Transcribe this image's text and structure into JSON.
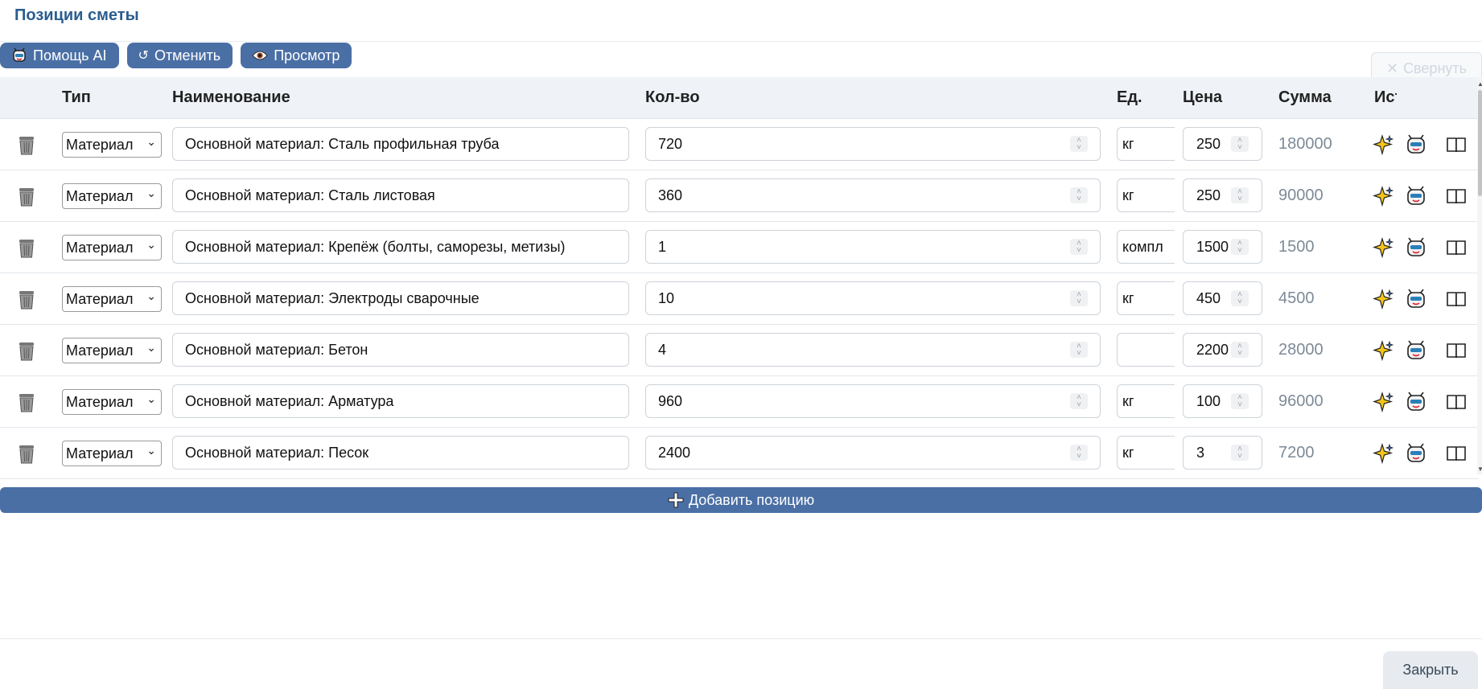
{
  "title": "Позиции сметы",
  "toolbar": {
    "ai_label": "Помощь AI",
    "undo_label": "Отменить",
    "preview_label": "Просмотр",
    "collapse_label": "Свернуть"
  },
  "columns": {
    "type": "Тип",
    "name": "Наименование",
    "qty": "Кол-во",
    "unit": "Ед.",
    "price": "Цена",
    "sum": "Сумма",
    "source": "Источник"
  },
  "rows": [
    {
      "type": "Материал",
      "name": "Основной материал: Сталь профильная труба",
      "qty": "720",
      "unit": "кг",
      "price": "250",
      "sum": "180000"
    },
    {
      "type": "Материал",
      "name": "Основной материал: Сталь листовая",
      "qty": "360",
      "unit": "кг",
      "price": "250",
      "sum": "90000"
    },
    {
      "type": "Материал",
      "name": "Основной материал: Крепёж (болты, саморезы, метизы)",
      "qty": "1",
      "unit": "компл",
      "price": "1500",
      "sum": "1500"
    },
    {
      "type": "Материал",
      "name": "Основной материал: Электроды сварочные",
      "qty": "10",
      "unit": "кг",
      "price": "450",
      "sum": "4500"
    },
    {
      "type": "Материал",
      "name": "Основной материал: Бетон",
      "qty": "4",
      "unit": "",
      "price": "2200",
      "sum": "28000"
    },
    {
      "type": "Материал",
      "name": "Основной материал: Арматура",
      "qty": "960",
      "unit": "кг",
      "price": "100",
      "sum": "96000"
    },
    {
      "type": "Материал",
      "name": "Основной материал: Песок",
      "qty": "2400",
      "unit": "кг",
      "price": "3",
      "sum": "7200"
    }
  ],
  "add_label": "Добавить позицию",
  "close_label": "Закрыть",
  "colors": {
    "accent": "#4a6fa5",
    "title": "#2a5d8f",
    "sum_text": "#7d8a97"
  },
  "icons": [
    "robot-icon",
    "undo-icon",
    "eye-icon",
    "close-icon",
    "trash-icon",
    "sparkle-icon",
    "book-icon",
    "plus-icon",
    "chevron-down-icon"
  ]
}
